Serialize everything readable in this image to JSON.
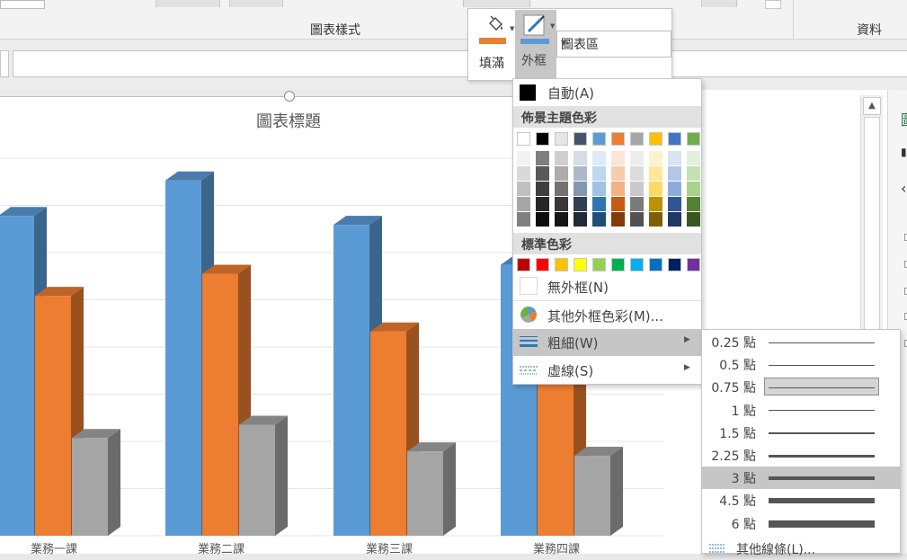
{
  "ribbon": {
    "chart_styles_group": "圖表樣式",
    "data_group": "資料"
  },
  "chart": {
    "title": "圖表標題",
    "categories": [
      "業務一課",
      "業務二課",
      "業務三課",
      "業務四課"
    ],
    "colors": {
      "series1": "#5b9bd5",
      "series2": "#ed7d31",
      "series3": "#a5a5a5"
    }
  },
  "chart_data": {
    "type": "bar",
    "title": "圖表標題",
    "categories": [
      "業務一課",
      "業務二課",
      "業務三課",
      "業務四課"
    ],
    "series": [
      {
        "values": [
          7.2,
          8.0,
          7.0,
          6.1
        ]
      },
      {
        "values": [
          5.4,
          5.9,
          4.6,
          4.7
        ]
      },
      {
        "values": [
          2.2,
          2.5,
          1.9,
          1.8
        ]
      }
    ],
    "ylim": [
      0,
      8.5
    ],
    "grid": true
  },
  "mini_toolbar": {
    "fill_label": "填滿",
    "outline_label": "外框",
    "element_combo": "圖表區",
    "fill_icon": "paint-bucket-icon",
    "outline_icon": "pen-icon"
  },
  "outline_menu": {
    "auto_label": "自動(A)",
    "theme_colors_label": "佈景主題色彩",
    "standard_colors_label": "標準色彩",
    "no_outline_label": "無外框(N)",
    "more_colors_label": "其他外框色彩(M)...",
    "weight_label": "粗細(W)",
    "dashes_label": "虛線(S)",
    "theme_row": [
      "#ffffff",
      "#000000",
      "#e7e6e6",
      "#44546a",
      "#5b9bd5",
      "#ed7d31",
      "#a5a5a5",
      "#ffc000",
      "#4472c4",
      "#70ad47"
    ],
    "theme_shades": [
      [
        "#f2f2f2",
        "#7f7f7f",
        "#d0cece",
        "#d6dce5",
        "#deebf7",
        "#fbe5d6",
        "#ededed",
        "#fff2cc",
        "#dae3f3",
        "#e2f0d9"
      ],
      [
        "#d9d9d9",
        "#595959",
        "#aeabab",
        "#adb9ca",
        "#bdd7ee",
        "#f8cbad",
        "#dbdbdb",
        "#ffe699",
        "#b4c7e7",
        "#c5e0b4"
      ],
      [
        "#bfbfbf",
        "#3f3f3f",
        "#757171",
        "#8497b0",
        "#9dc3e6",
        "#f4b183",
        "#c9c9c9",
        "#ffd966",
        "#8faadc",
        "#a9d18e"
      ],
      [
        "#a6a6a6",
        "#262626",
        "#3a3838",
        "#323f4f",
        "#2e75b6",
        "#c55a11",
        "#7b7b7b",
        "#bf9000",
        "#2f5597",
        "#548235"
      ],
      [
        "#808080",
        "#0d0d0d",
        "#171616",
        "#222a35",
        "#1f4e79",
        "#843c0c",
        "#525252",
        "#7f6000",
        "#203864",
        "#385723"
      ]
    ],
    "standard_row": [
      "#c00000",
      "#ff0000",
      "#ffc000",
      "#ffff00",
      "#92d050",
      "#00b050",
      "#00b0f0",
      "#0070c0",
      "#002060",
      "#7030a0"
    ]
  },
  "weight_menu": {
    "weights": [
      "0.25 點",
      "0.5 點",
      "0.75 點",
      "1 點",
      "1.5 點",
      "2.25 點",
      "3 點",
      "4.5 點",
      "6 點"
    ],
    "weight_values": [
      0.25,
      0.5,
      0.75,
      1,
      1.5,
      2.25,
      3,
      4.5,
      6
    ],
    "more_lines_label": "其他線條(L)..."
  }
}
